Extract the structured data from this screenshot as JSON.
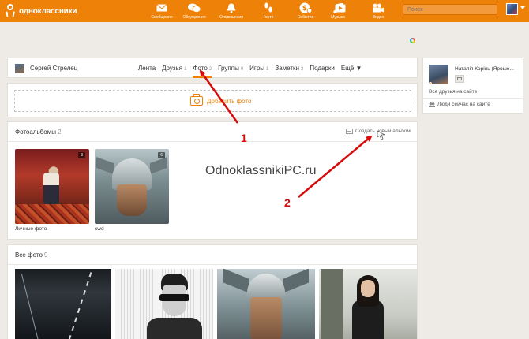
{
  "header": {
    "logo_text": "одноклассники",
    "nav": [
      {
        "label": "Сообщения",
        "icon": "envelope-icon"
      },
      {
        "label": "Обсуждения",
        "icon": "chat-bubbles-icon"
      },
      {
        "label": "Оповещения",
        "icon": "bell-icon"
      },
      {
        "label": "Гости",
        "icon": "footprints-icon"
      },
      {
        "label": "События",
        "icon": "money-badge-icon"
      },
      {
        "label": "Музыка",
        "icon": "music-note-icon"
      },
      {
        "label": "Видео",
        "icon": "video-camera-icon"
      }
    ],
    "search_placeholder": "Поиск"
  },
  "profile": {
    "name": "Сергей Стрелец",
    "tabs": [
      {
        "label": "Лента",
        "count": ""
      },
      {
        "label": "Друзья",
        "count": "1"
      },
      {
        "label": "Фото",
        "count": "2"
      },
      {
        "label": "Группы",
        "count": "0"
      },
      {
        "label": "Игры",
        "count": "1"
      },
      {
        "label": "Заметки",
        "count": "3"
      },
      {
        "label": "Подарки",
        "count": ""
      },
      {
        "label": "Ещё ▼",
        "count": ""
      }
    ],
    "active_tab": "Фото"
  },
  "add_photo": {
    "label": "Добавить фото"
  },
  "albums": {
    "title": "Фотоальбомы",
    "count": "2",
    "create_label": "Создать новый альбом",
    "items": [
      {
        "caption": "Личные фото",
        "badge": "3"
      },
      {
        "caption": "swd",
        "badge": "6"
      }
    ]
  },
  "watermark": "OdnoklassnikiPC.ru",
  "all_photos": {
    "title": "Все фото",
    "count": "9"
  },
  "sidebar": {
    "friend_name": "Наталія Корінь (Ярошe...",
    "friends_online": "Все друзья на сайте",
    "people_online": "Люди сейчас на сайте"
  },
  "annotations": {
    "num1": "1",
    "num2": "2"
  },
  "colors": {
    "brand": "#ee8208",
    "arrow": "#d60b0b",
    "background": "#eeebe6"
  }
}
